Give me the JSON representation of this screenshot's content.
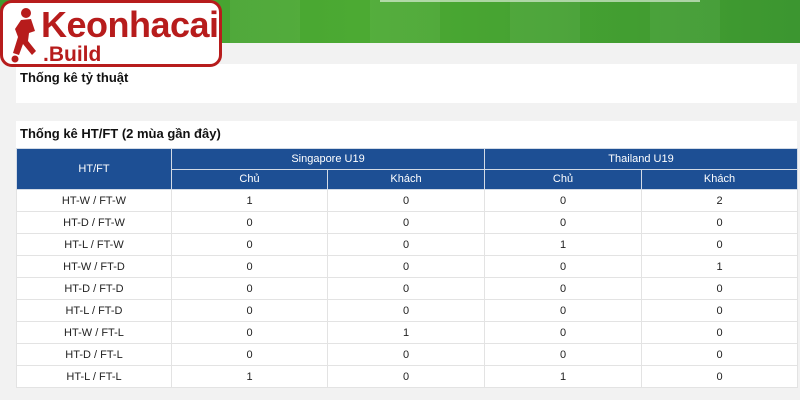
{
  "logo": {
    "main": "Keonhacai",
    "sub": ".Build"
  },
  "section_odds": {
    "title": "Thống kê tỷ thuật"
  },
  "section_htft": {
    "title": "Thống kê HT/FT (2 mùa gần đây)",
    "row_header": "HT/FT",
    "teams": [
      "Singapore U19",
      "Thailand U19"
    ],
    "sub_headers": [
      "Chủ",
      "Khách",
      "Chủ",
      "Khách"
    ],
    "rows": [
      [
        "HT-W / FT-W",
        "1",
        "0",
        "0",
        "2"
      ],
      [
        "HT-D / FT-W",
        "0",
        "0",
        "0",
        "0"
      ],
      [
        "HT-L / FT-W",
        "0",
        "0",
        "1",
        "0"
      ],
      [
        "HT-W / FT-D",
        "0",
        "0",
        "0",
        "1"
      ],
      [
        "HT-D / FT-D",
        "0",
        "0",
        "0",
        "0"
      ],
      [
        "HT-L / FT-D",
        "0",
        "0",
        "0",
        "0"
      ],
      [
        "HT-W / FT-L",
        "0",
        "1",
        "0",
        "0"
      ],
      [
        "HT-D / FT-L",
        "0",
        "0",
        "0",
        "0"
      ],
      [
        "HT-L / FT-L",
        "1",
        "0",
        "1",
        "0"
      ]
    ]
  },
  "colors": {
    "header_bg": "#1d4f94",
    "logo_red": "#b71c1c",
    "pitch_green": "#4caa33"
  }
}
